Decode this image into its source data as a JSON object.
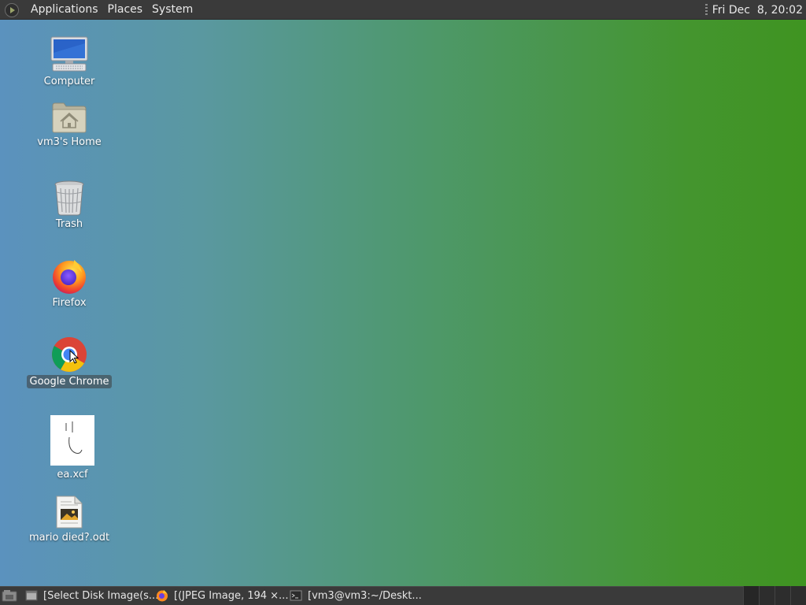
{
  "top_panel": {
    "menus": [
      "Applications",
      "Places",
      "System"
    ],
    "clock": "Fri Dec  8, 20:02"
  },
  "desktop_icons": [
    {
      "label": "Computer",
      "icon": "computer-icon"
    },
    {
      "label": "vm3's Home",
      "icon": "home-folder-icon"
    },
    {
      "label": "Trash",
      "icon": "trash-icon"
    },
    {
      "label": "Firefox",
      "icon": "firefox-icon"
    },
    {
      "label": "Google Chrome",
      "icon": "chrome-icon",
      "selected": true
    },
    {
      "label": "ea.xcf",
      "icon": "xcf-thumbnail-icon"
    },
    {
      "label": "mario died?.odt",
      "icon": "odt-document-icon"
    }
  ],
  "taskbar": {
    "tasks": [
      {
        "label": "[Select Disk Image(s...",
        "icon": "window-icon"
      },
      {
        "label": "[(JPEG Image, 194 ×...",
        "icon": "firefox-icon"
      },
      {
        "label": "[vm3@vm3:~/Deskt...",
        "icon": "terminal-icon"
      }
    ]
  },
  "colors": {
    "panel_bg": "#3a3a3a",
    "desktop_left": "#5b92be",
    "desktop_right": "#3f9421"
  }
}
